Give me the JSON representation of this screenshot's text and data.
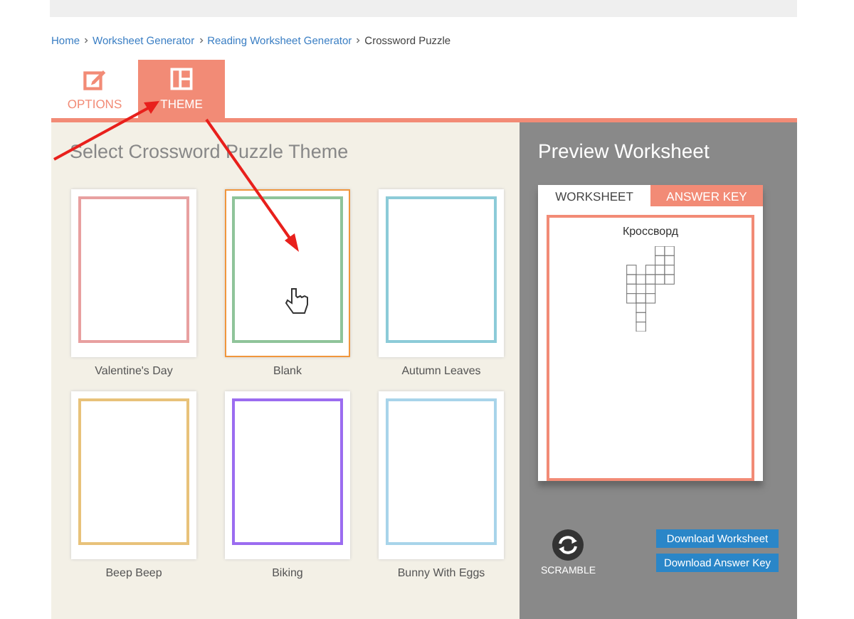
{
  "breadcrumb": [
    {
      "label": "Home",
      "current": false
    },
    {
      "label": "Worksheet Generator",
      "current": false
    },
    {
      "label": "Reading Worksheet Generator",
      "current": false
    },
    {
      "label": "Crossword Puzzle",
      "current": true
    }
  ],
  "tabs": [
    {
      "label": "OPTIONS",
      "selected": false
    },
    {
      "label": "THEME",
      "selected": true
    }
  ],
  "theme_panel": {
    "title": "Select Crossword Puzzle Theme",
    "themes": [
      {
        "name": "Valentine's Day",
        "color": "#e8a0a0",
        "selected": false
      },
      {
        "name": "Blank",
        "color": "#8fc49a",
        "selected": true
      },
      {
        "name": "Autumn Leaves",
        "color": "#8ccbd8",
        "selected": false
      },
      {
        "name": "Beep Beep",
        "color": "#e8c27a",
        "selected": false
      },
      {
        "name": "Biking",
        "color": "#9b6cf0",
        "selected": false
      },
      {
        "name": "Bunny With Eggs",
        "color": "#a8d4ea",
        "selected": false
      }
    ]
  },
  "preview": {
    "title": "Preview Worksheet",
    "tabs": [
      {
        "label": "WORKSHEET",
        "selected": true
      },
      {
        "label": "ANSWER KEY",
        "selected": false
      }
    ],
    "worksheet_title": "Кроссворд",
    "scramble_label": "SCRAMBLE",
    "buttons": [
      "Download Worksheet",
      "Download Answer Key"
    ]
  }
}
